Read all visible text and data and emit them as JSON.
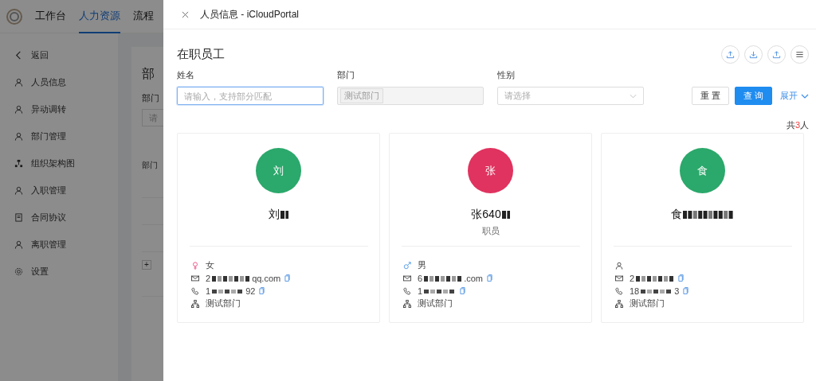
{
  "background_app": {
    "nav": [
      {
        "label": "工作台",
        "selected": false
      },
      {
        "label": "人力资源",
        "selected": true
      },
      {
        "label": "流程",
        "selected": false
      }
    ],
    "sidebar": [
      {
        "label": "返回",
        "kind": "back"
      },
      {
        "label": "人员信息",
        "kind": "person"
      },
      {
        "label": "异动调转",
        "kind": "person"
      },
      {
        "label": "部门管理",
        "kind": "person"
      },
      {
        "label": "组织架构图",
        "kind": "org"
      },
      {
        "label": "入职管理",
        "kind": "person"
      },
      {
        "label": "合同协议",
        "kind": "doc"
      },
      {
        "label": "离职管理",
        "kind": "person"
      },
      {
        "label": "设置",
        "kind": "gear"
      }
    ],
    "page_title": "部",
    "field_label": "部门",
    "field_placeholder": "请",
    "table_header": "部门",
    "row_expand": "+"
  },
  "drawer": {
    "title": "人员信息 - iCloudPortal",
    "heading": "在职员工",
    "filters": [
      {
        "kind": "text",
        "label": "姓名",
        "placeholder": "请输入，支持部分匹配",
        "focused": true
      },
      {
        "kind": "tag",
        "label": "部门",
        "tag": "测试部门",
        "disabled": true
      },
      {
        "kind": "select",
        "label": "性别",
        "placeholder": "请选择"
      }
    ],
    "buttons": {
      "reset": "重 置",
      "search": "查 询",
      "expand": "展开"
    },
    "total": {
      "prefix": "共",
      "count": "3",
      "suffix": "人"
    },
    "cards": [
      {
        "avatar": "刘",
        "color": "#2ba86b",
        "name": "刘",
        "kind": "female",
        "gender_label": "女",
        "email_start": "2",
        "email_end": "qq.com",
        "phone_start": "1",
        "phone_end": "92",
        "department": "测试部门"
      },
      {
        "avatar": "张",
        "color": "#e0335f",
        "name": "张640",
        "role": "职员",
        "kind": "male",
        "gender_label": "男",
        "email_start": "6",
        "email_end": ".com",
        "phone_start": "1",
        "department": "测试部门"
      },
      {
        "avatar": "食",
        "color": "#2ba86b",
        "name": "食",
        "kind": "unknown",
        "email_start": "2",
        "phone_start": "18",
        "phone_end": "3",
        "department": "测试部门"
      }
    ]
  }
}
